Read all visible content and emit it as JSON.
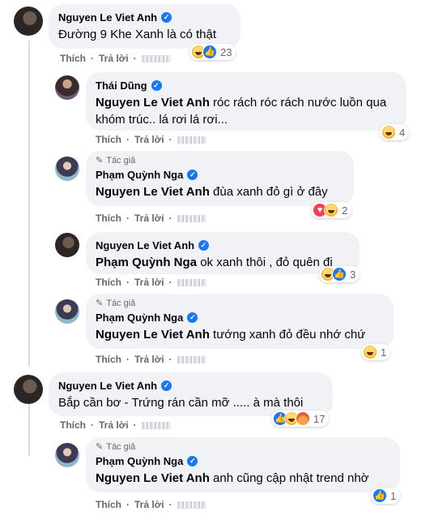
{
  "comments": [
    {
      "name": "Nguyen Le Viet Anh",
      "text": "Đường 9 Khe Xanh là có thật",
      "actions": {
        "like": "Thích",
        "reply": "Trả lời"
      },
      "reaction_count": "23"
    },
    {
      "name": "Thái Dũng",
      "tag": "Nguyen Le Viet Anh",
      "text": " róc rách róc rách nước luồn qua khóm trúc.. lá rơi lá rơi...",
      "actions": {
        "like": "Thích",
        "reply": "Trả lời"
      },
      "reaction_count": "4"
    },
    {
      "author_label": "Tác giả",
      "name": "Phạm Quỳnh Nga",
      "tag": "Nguyen Le Viet Anh",
      "text": " đùa xanh đỏ gì ở đây",
      "actions": {
        "like": "Thích",
        "reply": "Trả lời"
      },
      "reaction_count": "2"
    },
    {
      "name": "Nguyen Le Viet Anh",
      "tag": "Phạm Quỳnh Nga",
      "text": " ok xanh thôi , đỏ quên đi",
      "actions": {
        "like": "Thích",
        "reply": "Trả lời"
      },
      "reaction_count": "3"
    },
    {
      "author_label": "Tác giả",
      "name": "Phạm Quỳnh Nga",
      "tag": "Nguyen Le Viet Anh",
      "text": " tướng xanh đỏ đều nhớ chứ",
      "actions": {
        "like": "Thích",
        "reply": "Trả lời"
      },
      "reaction_count": "1"
    },
    {
      "name": "Nguyen Le Viet Anh",
      "text": "Bắp cần bơ - Trứng rán cần mỡ ..... à mà thôi",
      "actions": {
        "like": "Thích",
        "reply": "Trả lời"
      },
      "reaction_count": "17"
    },
    {
      "author_label": "Tác giả",
      "name": "Phạm Quỳnh Nga",
      "tag": "Nguyen Le Viet Anh",
      "text": " anh cũng cập nhật trend nhờ",
      "actions": {
        "like": "Thích",
        "reply": "Trả lời"
      },
      "reaction_count": "1"
    }
  ],
  "icons": {
    "verified": "verified-badge-icon",
    "author": "pencil-icon",
    "reactions": [
      "haha-icon",
      "like-icon",
      "love-icon",
      "angry-icon"
    ]
  },
  "colors": {
    "bubble": "#f0f2f5",
    "verified": "#1877f2",
    "meta_text": "#65676b"
  }
}
